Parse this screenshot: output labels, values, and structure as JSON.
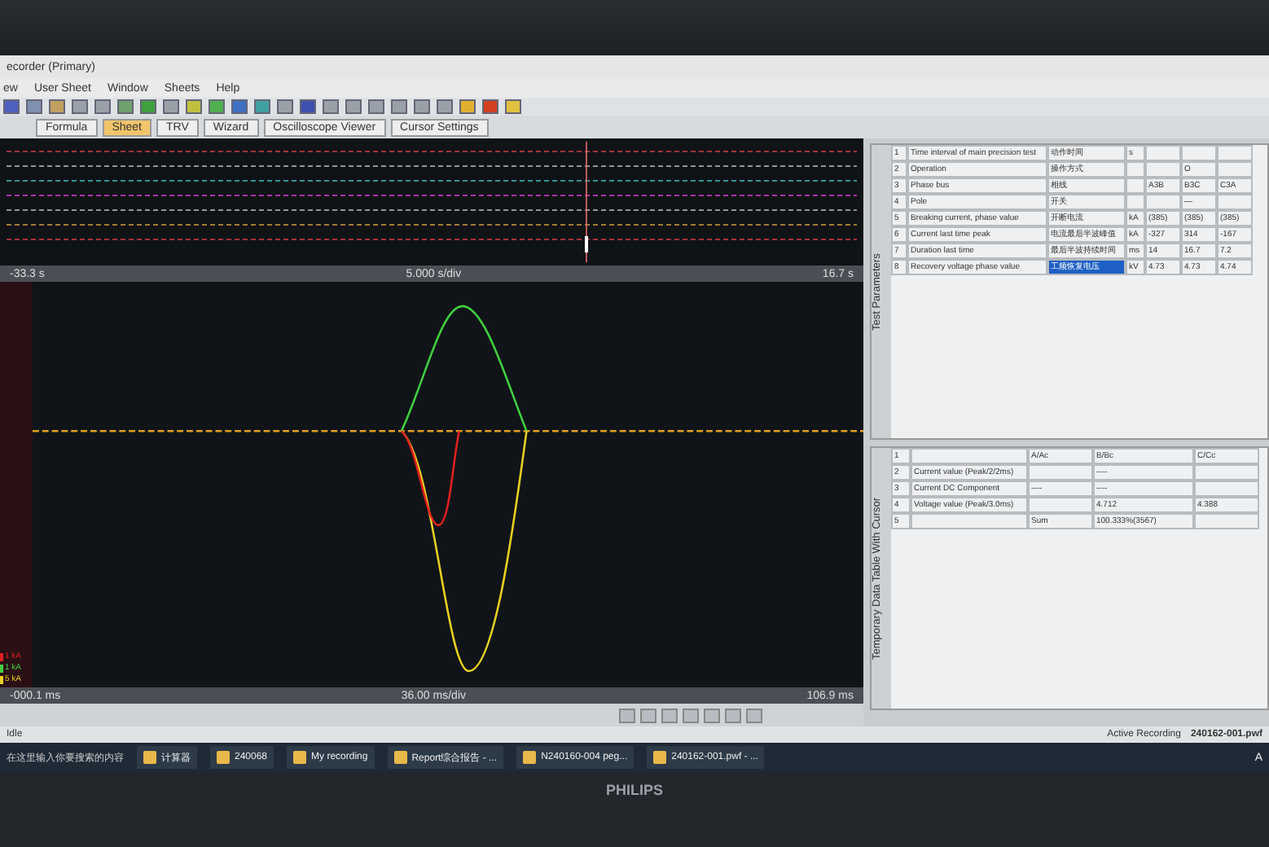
{
  "window": {
    "title": "ecorder (Primary)"
  },
  "menu": [
    "ew",
    "User Sheet",
    "Window",
    "Sheets",
    "Help"
  ],
  "sheet_tabs": [
    {
      "label": "Formula",
      "selected": false
    },
    {
      "label": "Sheet",
      "selected": true
    },
    {
      "label": "TRV",
      "selected": false
    },
    {
      "label": "Wizard",
      "selected": false
    },
    {
      "label": "Oscilloscope Viewer",
      "selected": false
    },
    {
      "label": "Cursor Settings",
      "selected": false
    }
  ],
  "overview": {
    "start": "-33.3 s",
    "scale": "5.000 s/div",
    "end": "16.7 s"
  },
  "channels": [
    {
      "label": "1 kA",
      "color": "#e02020"
    },
    {
      "label": "1 kA",
      "color": "#40d040"
    },
    {
      "label": "5 kA",
      "color": "#e8d020"
    }
  ],
  "waveform": {
    "start": "-000.1 ms",
    "scale": "36.00 ms/div",
    "end": "106.9 ms"
  },
  "test_parameters": {
    "title": "Test Parameters",
    "rows": [
      {
        "no": "1",
        "name": "Time interval of main precision test",
        "cn": "动作时间",
        "unit": "s",
        "a": "",
        "b": "",
        "c": "",
        "selected": false
      },
      {
        "no": "2",
        "name": "Operation",
        "cn": "操作方式",
        "unit": "",
        "a": "",
        "b": "O",
        "c": "",
        "selected": false
      },
      {
        "no": "3",
        "name": "Phase bus",
        "cn": "相线",
        "unit": "",
        "a": "A3B",
        "b": "B3C",
        "c": "C3A",
        "selected": false
      },
      {
        "no": "4",
        "name": "Pole",
        "cn": "开关",
        "unit": "",
        "a": "",
        "b": "—",
        "c": "",
        "selected": false
      },
      {
        "no": "5",
        "name": "Breaking current, phase value",
        "cn": "开断电流",
        "unit": "kA",
        "a": "(385)",
        "b": "(385)",
        "c": "(385)",
        "selected": false
      },
      {
        "no": "6",
        "name": "Current last time peak",
        "cn": "电流最后半波峰值",
        "unit": "kA",
        "a": "-327",
        "b": "314",
        "c": "-167",
        "selected": false
      },
      {
        "no": "7",
        "name": "Duration last time",
        "cn": "最后半波持续时间",
        "unit": "ms",
        "a": "14",
        "b": "16.7",
        "c": "7.2",
        "selected": false
      },
      {
        "no": "8",
        "name": "Recovery voltage phase value",
        "cn": "工频恢复电压",
        "unit": "kV",
        "a": "4.73",
        "b": "4.73",
        "c": "4.74",
        "selected": true
      }
    ]
  },
  "cursor_table": {
    "title": "Temporary Data Table With Cursor",
    "rows": [
      {
        "no": "1",
        "name": "",
        "a": "A/Ac",
        "b": "B/Bc",
        "c": "C/Cc"
      },
      {
        "no": "2",
        "name": "Current value (Peak/2/2ms)",
        "a": "",
        "b": "----",
        "c": ""
      },
      {
        "no": "3",
        "name": "Current DC Component",
        "a": "----",
        "b": "----",
        "c": ""
      },
      {
        "no": "4",
        "name": "Voltage value (Peak/3.0ms)",
        "a": "",
        "b": "4.712",
        "c": "4.388"
      },
      {
        "no": "5",
        "name": "",
        "a": "Sum",
        "b": "100.333%(3567)",
        "c": ""
      }
    ]
  },
  "status_bar": {
    "left": "Idle",
    "state": "Active Recording",
    "file": "240162-001.pwf"
  },
  "taskbar": {
    "search": "在这里输入你要搜索的内容",
    "apps": [
      "计算器",
      "240068",
      "My recording",
      "Report综合报告 - ...",
      "N240160-004 peg...",
      "240162-001.pwf - ..."
    ],
    "ime": "A"
  },
  "monitor": {
    "brand": "PHILIPS"
  }
}
